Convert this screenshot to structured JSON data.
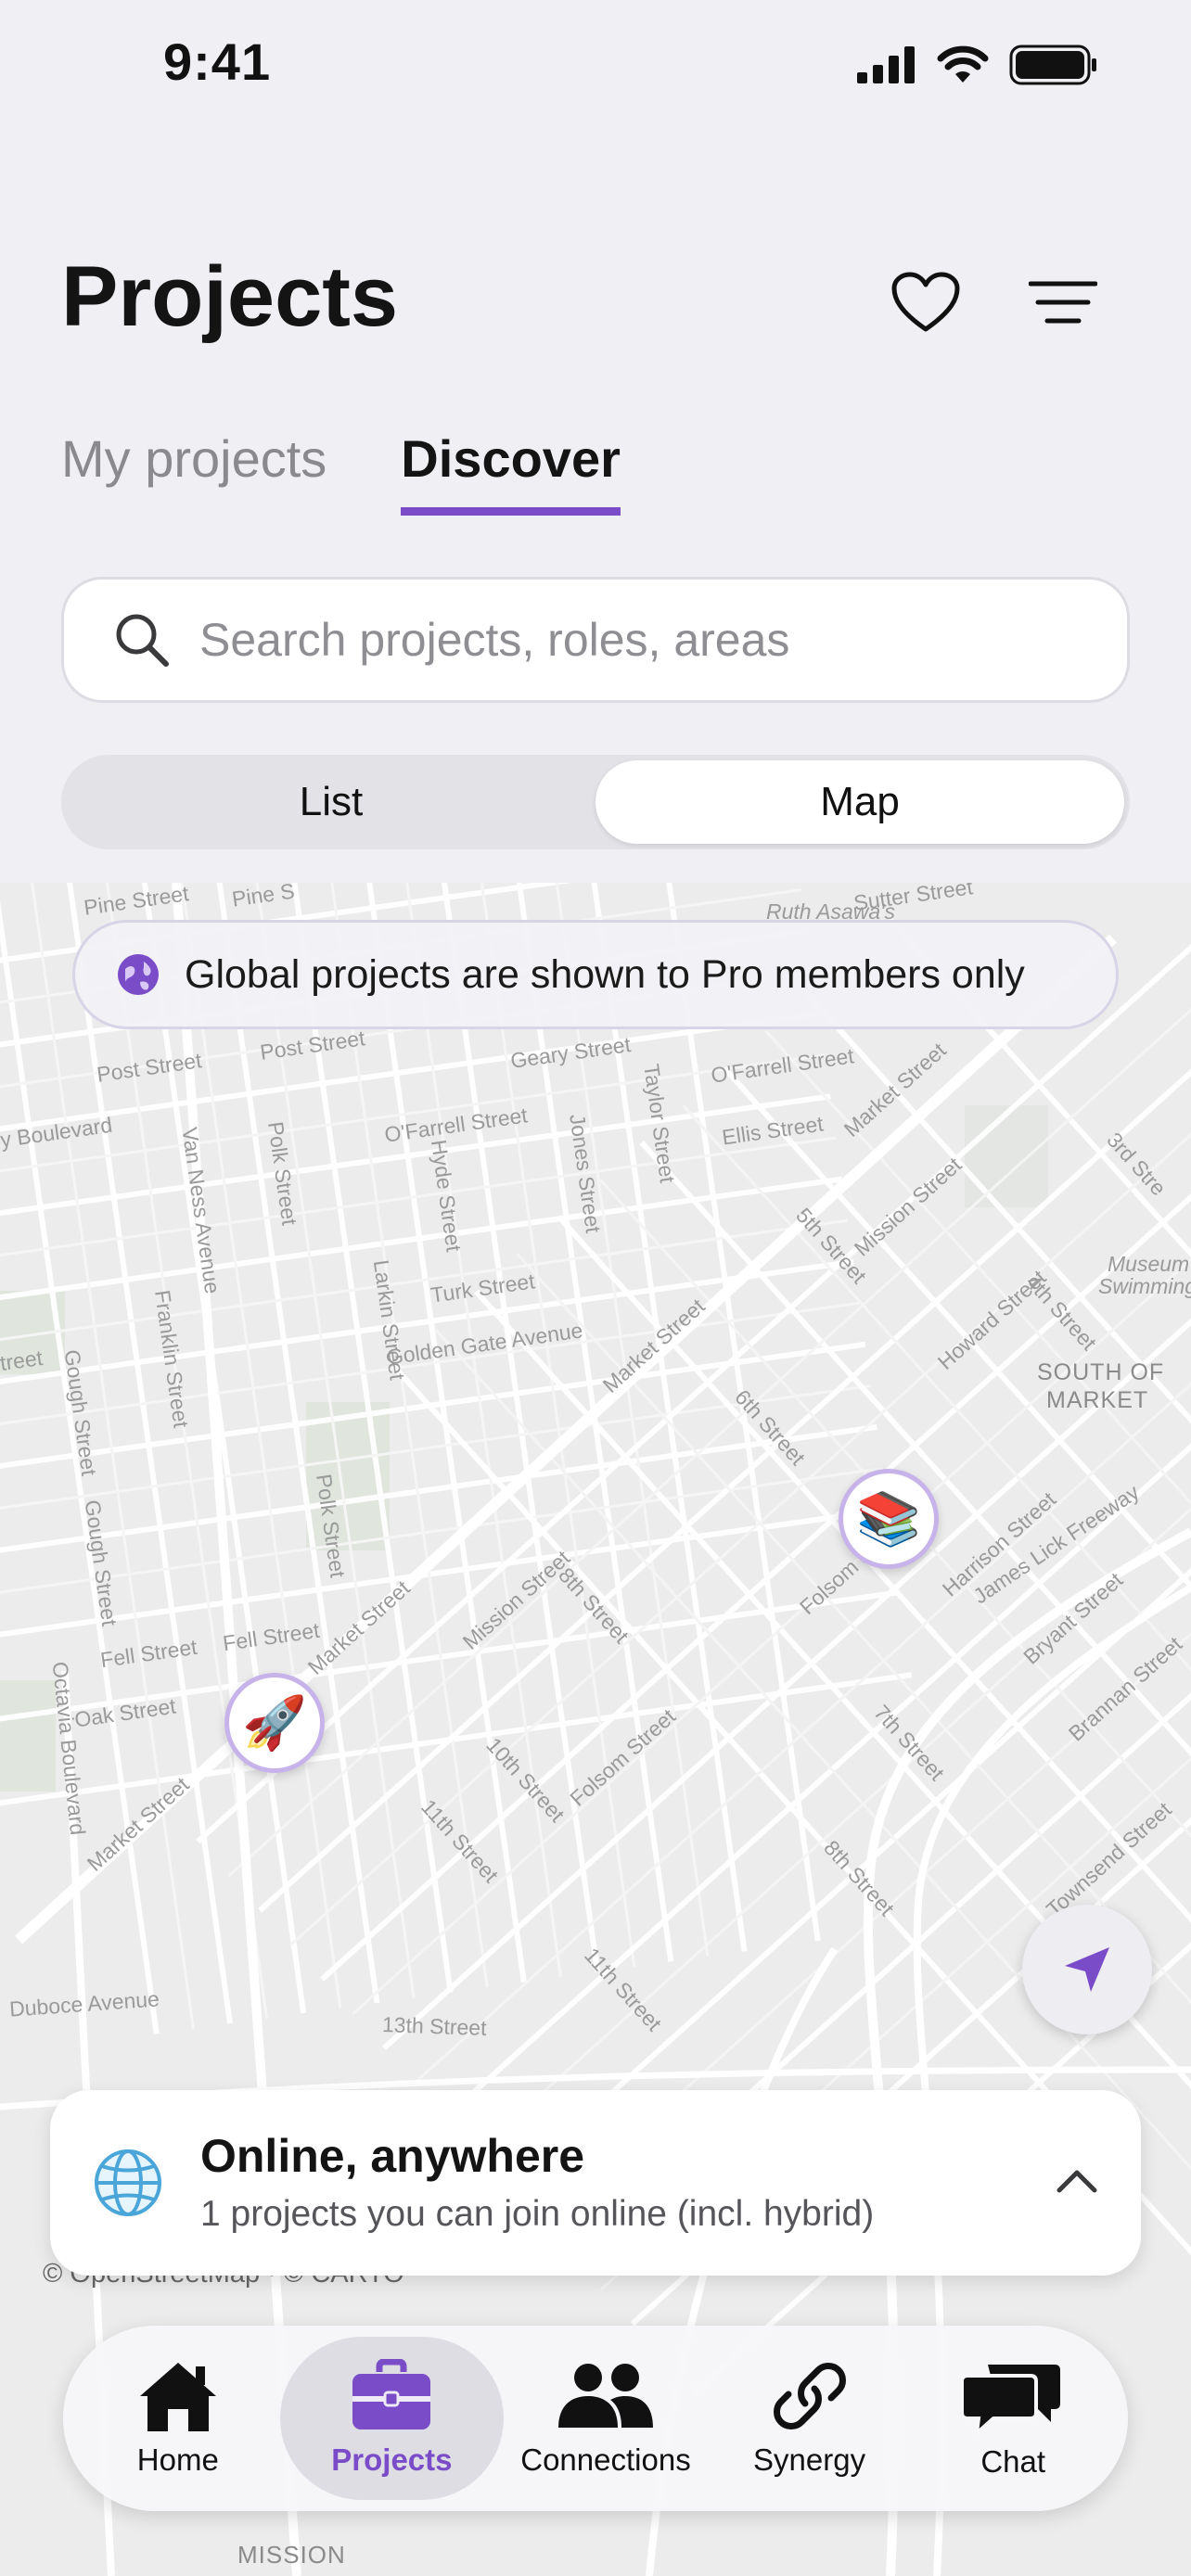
{
  "status_bar": {
    "time": "9:41"
  },
  "header": {
    "title": "Projects"
  },
  "tabs": [
    {
      "label": "My projects",
      "active": false
    },
    {
      "label": "Discover",
      "active": true
    }
  ],
  "search": {
    "placeholder": "Search projects, roles, areas",
    "value": ""
  },
  "view_toggle": {
    "list_label": "List",
    "map_label": "Map",
    "selected": "Map"
  },
  "map": {
    "banner_text": "Global projects are shown to Pro members only",
    "attribution": "© OpenStreetMap · © CARTO",
    "labels": {
      "pine_street": "Pine Street",
      "pine_street_2": "Pine S",
      "sutter_street": "Sutter Street",
      "ruth_asawa": "Ruth Asawa's",
      "post_street": "Post Street",
      "post_street_2": "Post Street",
      "geary_street": "Geary Street",
      "ofarrell_street": "O'Farrell Street",
      "ofarrell_street_2": "O'Farrell Street",
      "ellis_street": "Ellis Street",
      "market_street_ne": "Market Street",
      "boulevard": "y Boulevard",
      "van_ness": "Van Ness Avenue",
      "polk_street": "Polk Street",
      "hyde_street": "Hyde Street",
      "jones_street": "Jones Street",
      "taylor_street": "Taylor Street",
      "fifth_street": "5th Street",
      "mission_street_ne": "Mission Street",
      "third_street": "3rd Stre",
      "fourth_street": "4th Street",
      "howard_street": "Howard Street",
      "museum": "Museum",
      "swimming": "Swimming",
      "franklin_street": "Franklin Street",
      "larkin_street": "Larkin Street",
      "turk_street": "Turk Street",
      "golden_gate": "Golden Gate Avenue",
      "street_left": "treet",
      "gough_street": "Gough Street",
      "market_street_mid": "Market Street",
      "sixth_street": "6th Street",
      "south_of_market": "SOUTH OF",
      "south_of_market_2": "MARKET",
      "gough_street_2": "Gough Street",
      "polk_street_2": "Polk Street",
      "harrison_street": "Harrison Street",
      "james_lick": "James Lick Freeway",
      "bryant_street": "Bryant Street",
      "mission_street_mid": "Mission Street",
      "eighth_street": "8th Street",
      "folsom_street": "Folsom Stre",
      "fell_street": "Fell Street",
      "fell_street_2": "Fell Street",
      "market_street_sw": "Market Street",
      "brannan_street": "Brannan Street",
      "octavia": "Octavia Boulevard",
      "oak_street": "Oak Street",
      "seventh_street": "7th Street",
      "tenth_street": "10th Street",
      "folsom_street_2": "Folsom Street",
      "market_street_far": "Market Street",
      "eleventh_street": "11th Street",
      "eighth_street_2": "8th Street",
      "townsend": "Townsend Street",
      "duboce": "Duboce Avenue",
      "thirteenth": "13th Street",
      "eleventh_street_2": "11th Street",
      "mission_district": "MISSION"
    },
    "pins": [
      {
        "name": "books",
        "emoji": "📚"
      },
      {
        "name": "rocket",
        "emoji": "🚀"
      }
    ]
  },
  "online_card": {
    "title": "Online, anywhere",
    "subtitle": "1 projects you can join online (incl. hybrid)"
  },
  "tabbar": [
    {
      "label": "Home",
      "icon": "home-icon",
      "active": false
    },
    {
      "label": "Projects",
      "icon": "briefcase-icon",
      "active": true
    },
    {
      "label": "Connections",
      "icon": "people-icon",
      "active": false
    },
    {
      "label": "Synergy",
      "icon": "link-icon",
      "active": false
    },
    {
      "label": "Chat",
      "icon": "chat-bubbles-icon",
      "active": false
    }
  ],
  "colors": {
    "accent": "#7a4cc8",
    "background": "#efeff4",
    "map": "#ededed"
  }
}
